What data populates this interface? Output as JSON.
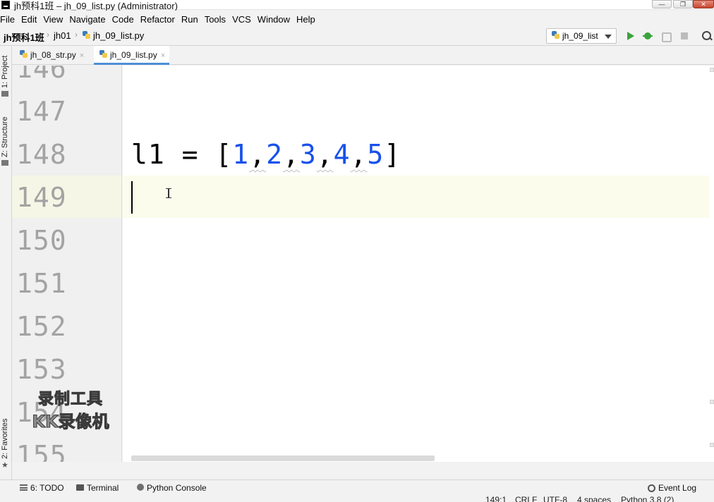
{
  "window": {
    "title": "jh预科1班 – jh_09_list.py (Administrator)",
    "minimize_glyph": "—",
    "maximize_glyph": "❐",
    "close_glyph": "✕"
  },
  "menu": [
    "File",
    "Edit",
    "View",
    "Navigate",
    "Code",
    "Refactor",
    "Run",
    "Tools",
    "VCS",
    "Window",
    "Help"
  ],
  "breadcrumb": {
    "project": "jh预科1班",
    "folder": "jh01",
    "file": "jh_09_list.py"
  },
  "run_config": {
    "selected": "jh_09_list"
  },
  "side_tabs": {
    "project": "1: Project",
    "structure": "Z: Structure",
    "favorites": "2: Favorites"
  },
  "tabs": [
    {
      "label": "jh_08_str.py",
      "active": false,
      "close": "×"
    },
    {
      "label": "jh_09_list.py",
      "active": true,
      "close": "×"
    }
  ],
  "editor": {
    "line_numbers": [
      "146",
      "147",
      "148",
      "149",
      "150",
      "151",
      "152",
      "153",
      "154",
      "155"
    ],
    "current_line": "149",
    "code": {
      "ident": "l1",
      "op": " = ",
      "open": "[",
      "n1": "1",
      "n2": "2",
      "n3": "3",
      "n4": "4",
      "n5": "5",
      "comma": ",",
      "close": "]"
    },
    "colors": {
      "number": "#1750eb",
      "line_number": "#a3a3a3",
      "current_line_bg": "#fcfcec"
    }
  },
  "watermark": {
    "line1": "录制工具",
    "line2": "KK录像机"
  },
  "bottom_tools": {
    "todo": "6: TODO",
    "terminal": "Terminal",
    "python_console": "Python Console",
    "event_log": "Event Log"
  },
  "status": {
    "position": "149:1",
    "line_sep": "CRLF",
    "encoding": "UTF-8",
    "indent": "4 spaces",
    "interpreter": "Python 3.8 (2)"
  }
}
